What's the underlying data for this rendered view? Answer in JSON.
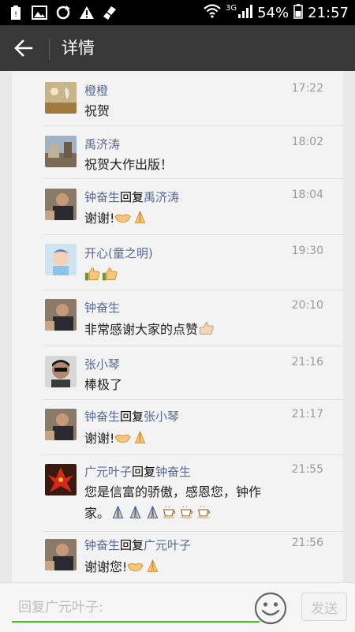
{
  "status_bar": {
    "battery": "54%",
    "time": "21:57",
    "network": "3G"
  },
  "header": {
    "title": "详情"
  },
  "reply_word": "回复",
  "comments": [
    {
      "name": "橙橙",
      "time": "17:22",
      "text": "祝贺"
    },
    {
      "name": "禹济涛",
      "time": "18:02",
      "text": "祝贺大作出版！"
    },
    {
      "name": "钟奋生",
      "reply_to": "禹济涛",
      "time": "18:04",
      "text": "谢谢!",
      "emojis": [
        "handshake",
        "pray"
      ]
    },
    {
      "name": "开心(童之明)",
      "time": "19:30",
      "text": "",
      "emojis": [
        "thumbs-up",
        "thumbs-up"
      ]
    },
    {
      "name": "钟奋生",
      "time": "20:10",
      "text": "非常感谢大家的点赞",
      "emojis": [
        "thumbs-up"
      ]
    },
    {
      "name": "张小琴",
      "time": "21:16",
      "text": "棒极了"
    },
    {
      "name": "钟奋生",
      "reply_to": "张小琴",
      "time": "21:17",
      "text": "谢谢!",
      "emojis": [
        "handshake",
        "pray"
      ]
    },
    {
      "name": "广元叶子",
      "reply_to": "钟奋生",
      "time": "21:55",
      "text_line1": "您是信富的骄傲，感恩您，钟作",
      "text_line2": "家。",
      "emojis": [
        "pray",
        "pray",
        "pray",
        "coffee",
        "coffee",
        "coffee"
      ]
    },
    {
      "name": "钟奋生",
      "reply_to": "广元叶子",
      "time": "21:56",
      "text": "谢谢您!",
      "emojis": [
        "handshake",
        "pray"
      ]
    }
  ],
  "input": {
    "placeholder": "回复广元叶子:",
    "send_label": "发送"
  }
}
